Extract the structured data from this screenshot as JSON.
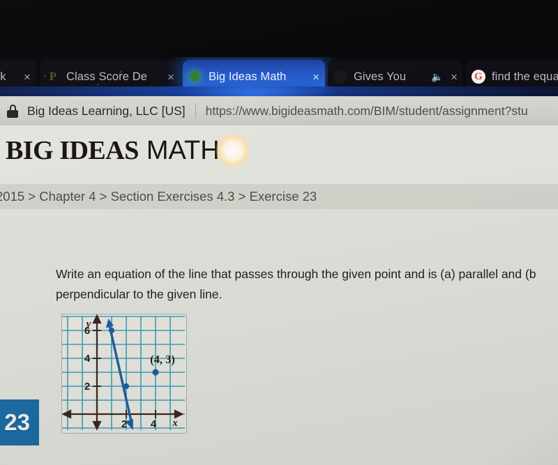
{
  "browser": {
    "tabs": [
      {
        "label": "ek",
        "favicon": "blank-favicon",
        "close_label": "×",
        "active": false,
        "muted": false
      },
      {
        "label": "Class Score De",
        "favicon": "letter-p-favicon",
        "close_label": "×",
        "active": false,
        "muted": false
      },
      {
        "label": "Big Ideas Math",
        "favicon": "green-diamond-favicon",
        "close_label": "×",
        "active": true,
        "muted": false
      },
      {
        "label": "Gives You",
        "favicon": "dark-favicon",
        "close_label": "×",
        "active": false,
        "muted": true,
        "speaker_glyph": "🔈"
      },
      {
        "label": "find the equa",
        "favicon": "google-favicon",
        "close_label": "×",
        "active": false,
        "muted": false
      }
    ],
    "omnibox": {
      "lock_icon": "lock-icon",
      "site_name": "Big Ideas Learning, LLC [US]",
      "url": "https://www.bigideasmath.com/BIM/student/assignment?stu"
    }
  },
  "site": {
    "logo_primary": "BIG IDEAS",
    "logo_secondary": "MATH",
    "breadcrumb": "2015 > Chapter 4 > Section Exercises 4.3 > Exercise 23"
  },
  "exercise": {
    "number": "23",
    "prompt": "Write an equation of the line that passes through the given point and is (a) parallel and (b\nperpendicular to the given line."
  },
  "colors": {
    "accent_blue": "#1c6ea4",
    "grid_teal": "#2e9cb8",
    "line_blue": "#1f5fa0",
    "axis_dark": "#3a2a20",
    "page_bg": "#e2e2dc",
    "breadcrumb_bg": "#d4d4cd",
    "omnibox_bg": "#d4d4cf",
    "tab_active_blue": "#2a6fe0"
  },
  "chart_data": {
    "type": "line",
    "title": "",
    "xlabel": "x",
    "ylabel": "y",
    "xlim": [
      -2,
      6
    ],
    "ylim": [
      -2,
      7
    ],
    "xticks": [
      2,
      4
    ],
    "yticks": [
      2,
      4,
      6
    ],
    "xtick_labels": [
      "2",
      "4"
    ],
    "ytick_labels": [
      "2",
      "4",
      "6"
    ],
    "grid": true,
    "grid_step": 1,
    "legend": "none",
    "series": [
      {
        "name": "given line",
        "type": "line",
        "points": [
          [
            1,
            6
          ],
          [
            2,
            2
          ]
        ],
        "slope": -4,
        "arrow_both_ends": true,
        "marker_points": [
          [
            1,
            6
          ],
          [
            2,
            2
          ]
        ],
        "color": "#1f5fa0"
      },
      {
        "name": "given point",
        "type": "scatter",
        "points": [
          [
            4,
            3
          ]
        ],
        "labels": [
          "(4, 3)"
        ],
        "color": "#1f5fa0"
      }
    ],
    "annotations": [
      {
        "text": "(4, 3)",
        "x": 4,
        "y": 3.8
      },
      {
        "text": "y",
        "x": -0.45,
        "y": 6.75
      },
      {
        "text": "x",
        "x": 5.6,
        "y": -0.75
      }
    ]
  }
}
